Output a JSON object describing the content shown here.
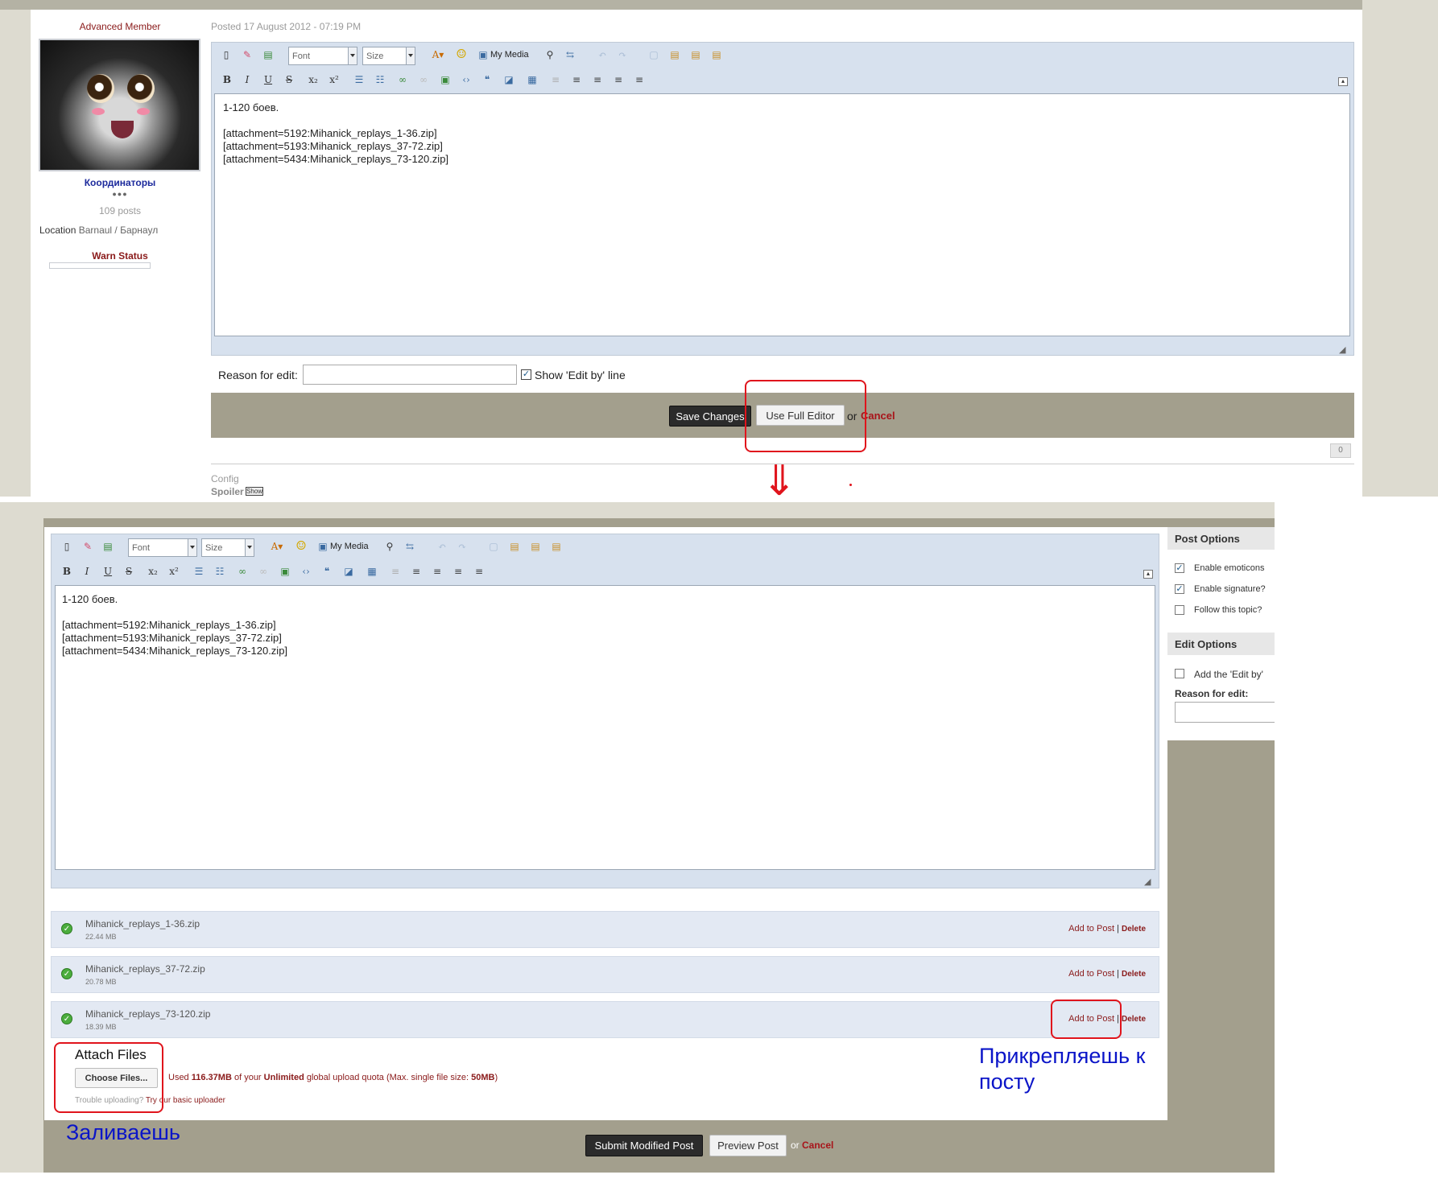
{
  "top": {
    "member_title": "Advanced Member",
    "group": "Координаторы",
    "pips": "●●●",
    "posts": "109 posts",
    "location_label": "Location",
    "location_value": "Barnaul / Барнаул",
    "warn_status": "Warn Status",
    "posted": "Posted 17 August 2012 - 07:19 PM",
    "font_label": "Font",
    "size_label": "Size",
    "my_media": "My Media",
    "editor_lines": [
      "1-120 боев.",
      "",
      "[attachment=5192:Mihanick_replays_1-36.zip]",
      "[attachment=5193:Mihanick_replays_37-72.zip]",
      "[attachment=5434:Mihanick_replays_73-120.zip]"
    ],
    "reason_label": "Reason for edit:",
    "reason_value": "",
    "show_edit_by": "Show 'Edit by' line",
    "save_changes": "Save Changes",
    "use_full_editor": "Use Full Editor",
    "or": "or",
    "cancel": "Cancel",
    "rep_count": "0",
    "sig_config": "Config",
    "sig_spoiler": "Spoiler",
    "sig_show": "Show"
  },
  "arrow": "⇓",
  "bottom": {
    "font_label": "Font",
    "size_label": "Size",
    "my_media": "My Media",
    "editor_lines": [
      "1-120 боев.",
      "",
      "[attachment=5192:Mihanick_replays_1-36.zip]",
      "[attachment=5193:Mihanick_replays_37-72.zip]",
      "[attachment=5434:Mihanick_replays_73-120.zip]"
    ],
    "files": [
      {
        "name": "Mihanick_replays_1-36.zip",
        "size": "22.44 MB",
        "add": "Add to Post",
        "sep": "|",
        "delete": "Delete"
      },
      {
        "name": "Mihanick_replays_37-72.zip",
        "size": "20.78 MB",
        "add": "Add to Post",
        "sep": "|",
        "delete": "Delete"
      },
      {
        "name": "Mihanick_replays_73-120.zip",
        "size": "18.39 MB",
        "add": "Add to Post",
        "sep": "|",
        "delete": "Delete"
      }
    ],
    "attach_title": "Attach Files",
    "choose_files": "Choose Files...",
    "quota_used": "Used",
    "quota_amount": "116.37MB",
    "quota_of": "of your",
    "quota_unlimited": "Unlimited",
    "quota_rest": "global upload quota (Max. single file size:",
    "quota_max": "50MB",
    "quota_close": ")",
    "trouble": "Trouble uploading?",
    "try_basic": "Try our basic uploader",
    "annotation_attach": "Прикрепляешь к посту",
    "annotation_upload": "Заливаешь",
    "submit": "Submit Modified Post",
    "preview": "Preview Post",
    "or": "or",
    "cancel": "Cancel",
    "post_options": "Post Options",
    "enable_emoticons": "Enable emoticons",
    "enable_signature": "Enable signature?",
    "follow_topic": "Follow this topic?",
    "edit_options": "Edit Options",
    "add_edit_by": "Add the 'Edit by'",
    "reason_label": "Reason for edit:"
  },
  "colors": {
    "accent_red": "#e0141c",
    "annotation_blue": "#0a14c8",
    "toolbar_bg": "#d7e1ee",
    "footer_bar": "#a39f8d"
  }
}
